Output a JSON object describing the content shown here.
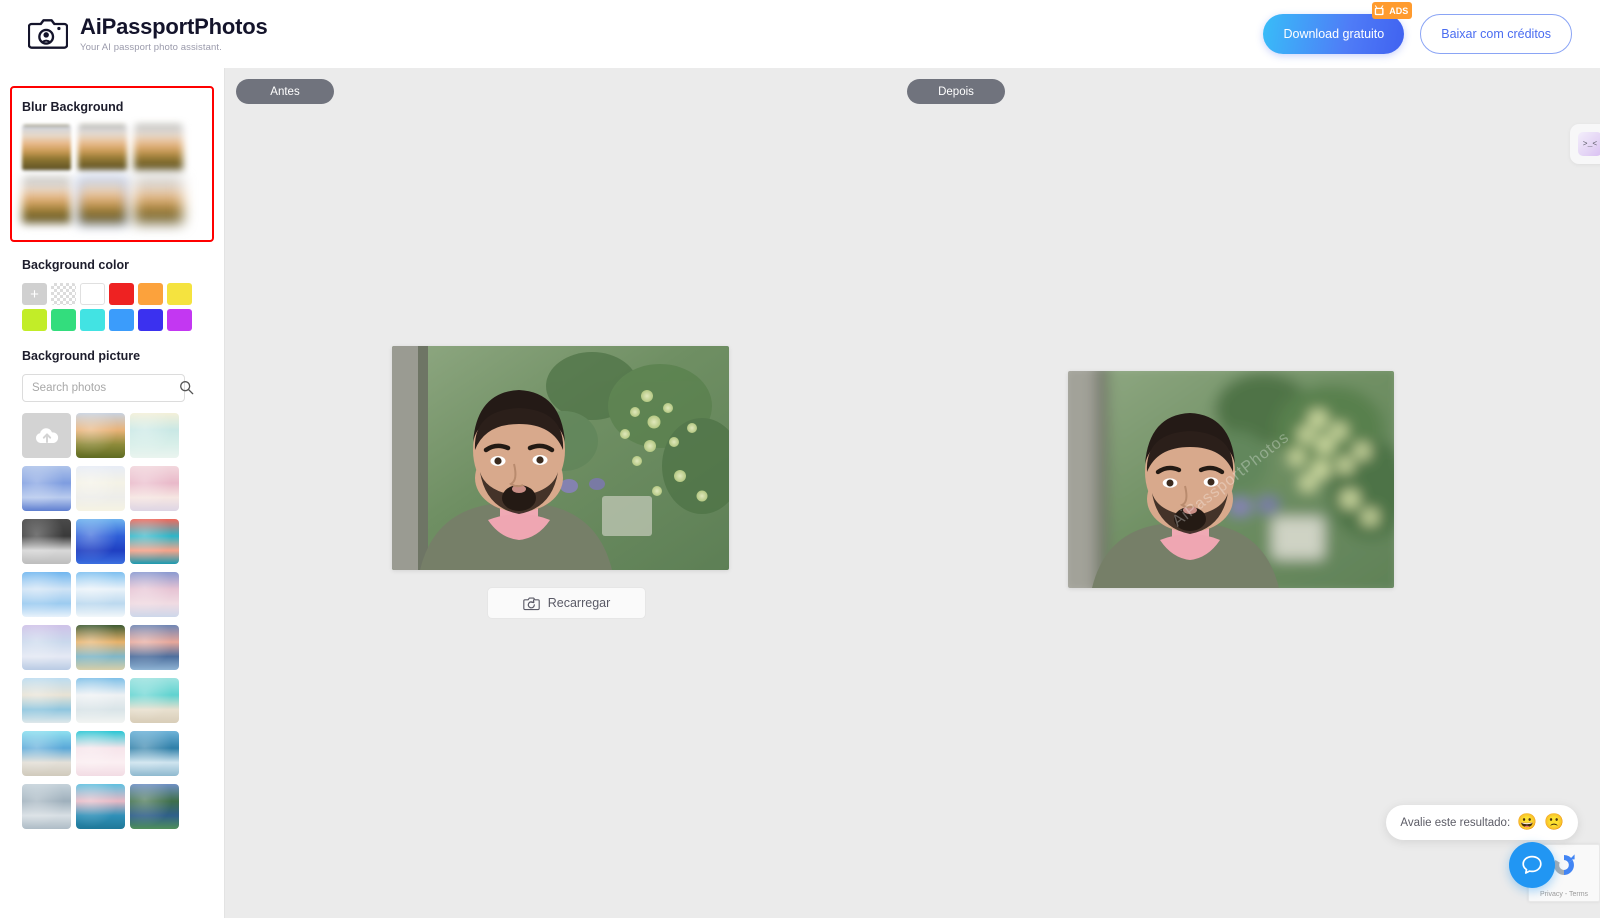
{
  "header": {
    "brand_title": "AiPassportPhotos",
    "brand_subtitle": "Your AI passport photo assistant.",
    "logo_icon": "camera-icon",
    "download_free_label": "Download gratuito",
    "ads_badge_label": "ADS",
    "ads_badge_icon": "tv-icon",
    "download_credits_label": "Baixar com créditos"
  },
  "sidebar": {
    "blur_background": {
      "title": "Blur Background",
      "highlight_color": "#ff0000",
      "selected_index": 4,
      "thumbs": [
        {
          "name": "blur-level-1"
        },
        {
          "name": "blur-level-2"
        },
        {
          "name": "blur-level-3"
        },
        {
          "name": "blur-level-4"
        },
        {
          "name": "blur-level-5"
        },
        {
          "name": "blur-level-6"
        }
      ]
    },
    "background_color": {
      "title": "Background color",
      "swatches": [
        {
          "name": "add-color",
          "type": "add",
          "color": "#d0d0d0"
        },
        {
          "name": "transparent",
          "type": "transparent",
          "color": "transparent"
        },
        {
          "name": "white",
          "type": "solid",
          "color": "#ffffff"
        },
        {
          "name": "red",
          "type": "solid",
          "color": "#ee2222"
        },
        {
          "name": "orange",
          "type": "solid",
          "color": "#fca23c"
        },
        {
          "name": "yellow",
          "type": "solid",
          "color": "#f5e33f"
        },
        {
          "name": "lime",
          "type": "solid",
          "color": "#c2ed28"
        },
        {
          "name": "green",
          "type": "solid",
          "color": "#33dd7d"
        },
        {
          "name": "cyan",
          "type": "solid",
          "color": "#42e3e3"
        },
        {
          "name": "blue",
          "type": "solid",
          "color": "#3b9cfb"
        },
        {
          "name": "indigo",
          "type": "solid",
          "color": "#3b31ef"
        },
        {
          "name": "magenta",
          "type": "solid",
          "color": "#c337f2"
        }
      ]
    },
    "background_picture": {
      "title": "Background picture",
      "search_placeholder": "Search photos",
      "search_value": "",
      "search_icon": "search-icon",
      "thumbs": [
        {
          "name": "upload-photo",
          "type": "upload",
          "icon": "cloud-upload-icon"
        },
        {
          "name": "city-sunset",
          "type": "image",
          "c1": "#c8d2e0",
          "c2": "#e9b277",
          "c3": "#8d8a3a",
          "c4": "#5e6b22"
        },
        {
          "name": "pastel-mint",
          "type": "image",
          "c1": "#f3f0d9",
          "c2": "#c9e8e5",
          "c3": "#d8efe9",
          "c4": "#eaf4ef"
        },
        {
          "name": "blue-watercolor",
          "type": "image",
          "c1": "#aec3ea",
          "c2": "#7e9de0",
          "c3": "#b9cbee",
          "c4": "#5f7fd0"
        },
        {
          "name": "cream-paper",
          "type": "image",
          "c1": "#e7ecf6",
          "c2": "#f4f2e6",
          "c3": "#ededea",
          "c4": "#f6f3e3"
        },
        {
          "name": "pink-clouds",
          "type": "image",
          "c1": "#f2d7dd",
          "c2": "#e9b9c9",
          "c3": "#f6e6e2",
          "c4": "#ddd5e4"
        },
        {
          "name": "gray-texture",
          "type": "image",
          "c1": "#4a4a4a",
          "c2": "#3a3a3a",
          "c3": "#d8d8d8",
          "c4": "#bdbdbd"
        },
        {
          "name": "blue-ink",
          "type": "image",
          "c1": "#6fb3ef",
          "c2": "#2f5fd8",
          "c3": "#1f3fc2",
          "c4": "#3b6fe0"
        },
        {
          "name": "coral-teal-paint",
          "type": "image",
          "c1": "#f06a5d",
          "c2": "#2bb6c9",
          "c3": "#f7a38a",
          "c4": "#1b9ab0"
        },
        {
          "name": "blue-sky-clouds",
          "type": "image",
          "c1": "#6fb6ef",
          "c2": "#cfe3f5",
          "c3": "#9ccbf0",
          "c4": "#e8f2fb"
        },
        {
          "name": "rainbow-sky",
          "type": "image",
          "c1": "#7ec0f0",
          "c2": "#e9f2f9",
          "c3": "#bcd9ef",
          "c4": "#f2f7fa"
        },
        {
          "name": "pink-cloud-sky",
          "type": "image",
          "c1": "#8b9ad0",
          "c2": "#e6c3d3",
          "c3": "#f0dbe2",
          "c4": "#cdd7ea"
        },
        {
          "name": "moon-sky",
          "type": "image",
          "c1": "#cfc2e8",
          "c2": "#c9d8ec",
          "c3": "#e5e9f4",
          "c4": "#b9cbe4"
        },
        {
          "name": "palm-sunset",
          "type": "image",
          "c1": "#3d5a33",
          "c2": "#e8b26a",
          "c3": "#7fb7c9",
          "c4": "#d8cfa8"
        },
        {
          "name": "ocean-sunset",
          "type": "image",
          "c1": "#6f86b4",
          "c2": "#e8a79a",
          "c3": "#4e6f9e",
          "c4": "#8fb4d4"
        },
        {
          "name": "beach-palms",
          "type": "image",
          "c1": "#bcdcf0",
          "c2": "#e8e2d4",
          "c3": "#8fc6df",
          "c4": "#dfe8ea"
        },
        {
          "name": "beach-umbrella",
          "type": "image",
          "c1": "#7fc0e8",
          "c2": "#eef1f3",
          "c3": "#d9e4e8",
          "c4": "#f2f4f2"
        },
        {
          "name": "turquoise-beach",
          "type": "image",
          "c1": "#9fe3e0",
          "c2": "#5fd3d0",
          "c3": "#e8e0cf",
          "c4": "#d8cdb8"
        },
        {
          "name": "blue-car-beach",
          "type": "image",
          "c1": "#8fe0f0",
          "c2": "#5aa8d8",
          "c3": "#e4e0d8",
          "c4": "#d0cabc"
        },
        {
          "name": "pink-beach",
          "type": "image",
          "c1": "#29c6d4",
          "c2": "#f6e4ea",
          "c3": "#fbeff2",
          "c4": "#f2dce4"
        },
        {
          "name": "pier-ocean",
          "type": "image",
          "c1": "#6fb3d8",
          "c2": "#2f7fa8",
          "c3": "#cfe4ef",
          "c4": "#8fb9cf"
        },
        {
          "name": "misty-mountain",
          "type": "image",
          "c1": "#c5d2da",
          "c2": "#9fb0bc",
          "c3": "#d8dfe4",
          "c4": "#aebcc6"
        },
        {
          "name": "coastal-clouds",
          "type": "image",
          "c1": "#5fc0e0",
          "c2": "#e8b8c4",
          "c3": "#2f90b8",
          "c4": "#1f7898"
        },
        {
          "name": "green-valley",
          "type": "image",
          "c1": "#6f90c4",
          "c2": "#3f6f4a",
          "c3": "#2f5f8a",
          "c4": "#4f8f5a"
        }
      ]
    }
  },
  "canvas": {
    "before_label": "Antes",
    "after_label": "Depois",
    "reload_label": "Recarregar",
    "reload_icon": "camera-refresh-icon",
    "before_photo_name": "portrait-original",
    "after_photo_name": "portrait-blurred-background",
    "watermark_text": "AiPassportPhotos",
    "mini_card_face": ">_<",
    "mini_card_name": "kawaii-face-icon"
  },
  "rating": {
    "label": "Avalie este resultado:",
    "happy_emoji": "😀",
    "sad_emoji": "🙁"
  },
  "chat": {
    "icon": "chat-bubble-icon",
    "color": "#2196f3"
  },
  "recaptcha": {
    "text": "Privacy - Terms",
    "icon": "recaptcha-icon"
  }
}
